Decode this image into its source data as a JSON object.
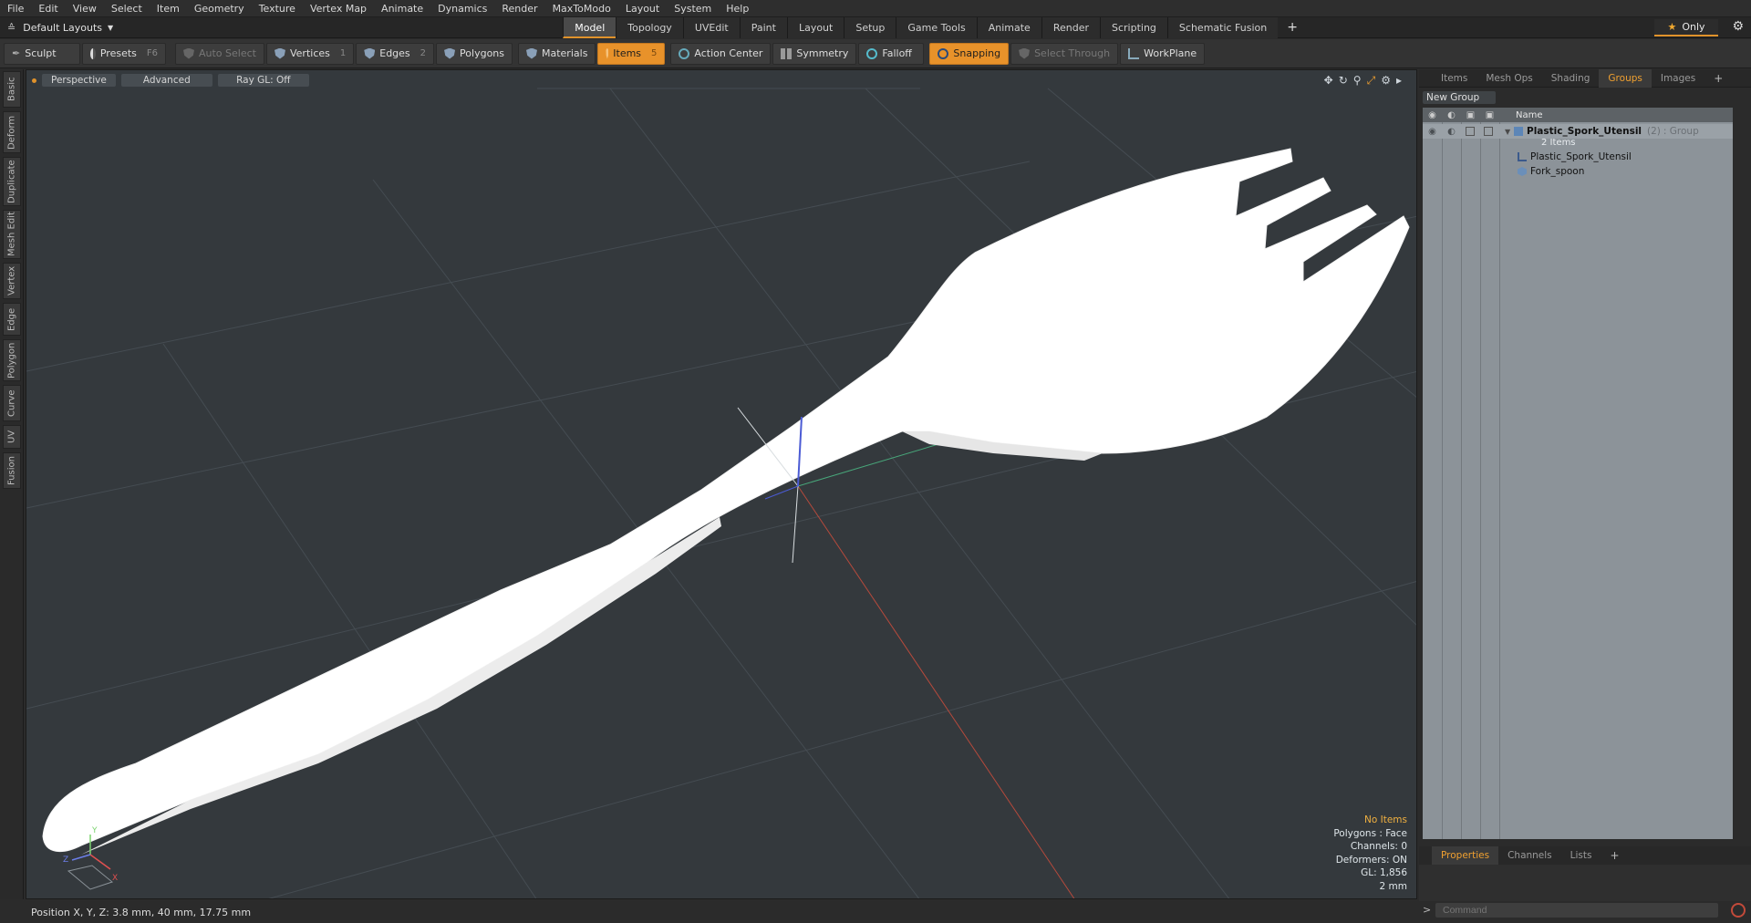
{
  "menu": [
    "File",
    "Edit",
    "View",
    "Select",
    "Item",
    "Geometry",
    "Texture",
    "Vertex Map",
    "Animate",
    "Dynamics",
    "Render",
    "MaxToModo",
    "Layout",
    "System",
    "Help"
  ],
  "layout": {
    "label": "Default Layouts",
    "only_label": "Only"
  },
  "mode_tabs": [
    "Model",
    "Topology",
    "UVEdit",
    "Paint",
    "Layout",
    "Setup",
    "Game Tools",
    "Animate",
    "Render",
    "Scripting",
    "Schematic Fusion"
  ],
  "active_mode_tab": "Model",
  "toolbar": {
    "sculpt": "Sculpt",
    "presets": "Presets",
    "presets_key": "F6",
    "auto_select": "Auto Select",
    "vertices": "Vertices",
    "vertices_count": "1",
    "edges": "Edges",
    "edges_count": "2",
    "polygons": "Polygons",
    "materials": "Materials",
    "items": "Items",
    "items_count": "5",
    "action_center": "Action Center",
    "symmetry": "Symmetry",
    "falloff": "Falloff",
    "snapping": "Snapping",
    "select_through": "Select Through",
    "workplane": "WorkPlane"
  },
  "left_tabs": [
    "Basic",
    "Deform",
    "Duplicate",
    "Mesh Edit",
    "Vertex",
    "Edge",
    "Polygon",
    "Curve",
    "UV",
    "Fusion"
  ],
  "viewport": {
    "view": "Perspective",
    "shading": "Advanced",
    "raygl": "Ray GL: Off",
    "stats": {
      "selection": "No Items",
      "polygons": "Polygons : Face",
      "channels": "Channels: 0",
      "deformers": "Deformers: ON",
      "gl": "GL: 1,856",
      "grid": "2 mm"
    },
    "axis": {
      "x": "X",
      "y": "Y",
      "z": "Z"
    }
  },
  "status": {
    "position": "Position X, Y, Z:  3.8 mm, 40 mm, 17.75 mm"
  },
  "right_panel": {
    "tabs": [
      "Items",
      "Mesh Ops",
      "Shading",
      "Groups",
      "Images"
    ],
    "active_tab": "Groups",
    "new_group": "New Group",
    "tree_header": "Name",
    "group": {
      "name": "Plastic_Spork_Utensil",
      "count": "(2)",
      "type": ": Group",
      "items_label": "2 Items"
    },
    "children": [
      "Plastic_Spork_Utensil",
      "Fork_spoon"
    ],
    "bottom_tabs": [
      "Properties",
      "Channels",
      "Lists"
    ],
    "active_bottom_tab": "Properties",
    "command_placeholder": "Command"
  }
}
